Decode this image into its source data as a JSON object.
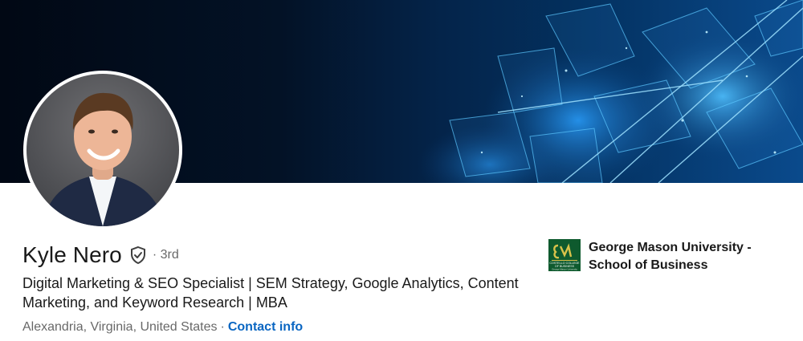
{
  "profile": {
    "name": "Kyle Nero",
    "degree": "· 3rd",
    "headline": "Digital Marketing & SEO Specialist | SEM Strategy, Google Analytics, Content Marketing, and Keyword Research | MBA",
    "location": "Alexandria, Virginia, United States",
    "separator": "·",
    "contact_label": "Contact info"
  },
  "education": {
    "school": "George Mason University - School of Business",
    "logo_lines": [
      "COSTELLO COLLEGE",
      "OF BUSINESS",
      "George Mason University"
    ]
  },
  "icons": {
    "verification": "shield-check-icon",
    "school_logo": "school-logo"
  },
  "colors": {
    "link": "#0a66c2",
    "banner_dark": "#010814",
    "banner_accent": "#1e8bff",
    "logo_green": "#0e5a2e"
  }
}
